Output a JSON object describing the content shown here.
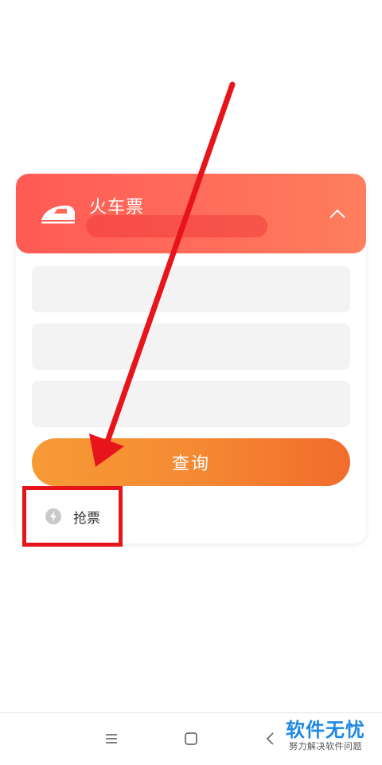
{
  "card": {
    "header_title": "火车票",
    "query_label": "查询",
    "grab_label": "抢票"
  },
  "icons": {
    "train": "train-icon",
    "collapse": "chevron-up-icon",
    "bolt": "bolt-icon"
  },
  "colors": {
    "header_gradient_start": "#ff5a55",
    "header_gradient_end": "#ff7e5e",
    "button_gradient_start": "#f79a36",
    "button_gradient_end": "#f16c2c",
    "annotation_red": "#e8141c",
    "watermark_blue": "#1e88e5"
  },
  "watermark": {
    "main": "软件无忧",
    "sub": "努力解决软件问题"
  },
  "nav": {
    "menu": "menu-icon",
    "home": "home-icon",
    "back": "back-icon"
  }
}
